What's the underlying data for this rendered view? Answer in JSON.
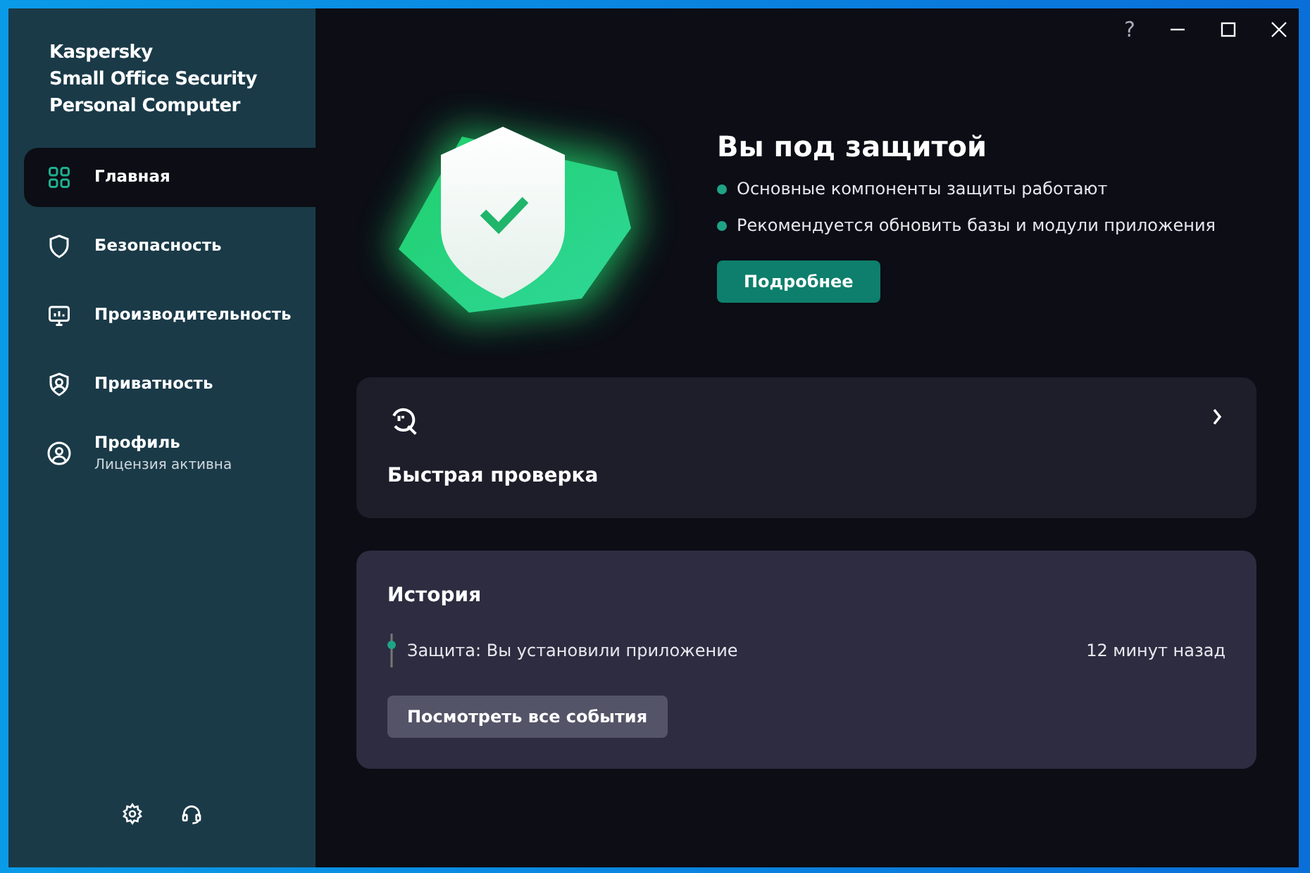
{
  "app": {
    "title_lines": [
      "Kaspersky",
      "Small Office Security",
      "Personal Computer"
    ]
  },
  "nav": [
    {
      "label": "Главная",
      "selected": true
    },
    {
      "label": "Безопасность",
      "selected": false
    },
    {
      "label": "Производительность",
      "selected": false
    },
    {
      "label": "Приватность",
      "selected": false
    },
    {
      "label": "Профиль",
      "sublabel": "Лицензия активна",
      "selected": false
    }
  ],
  "help": "?",
  "status": {
    "title": "Вы под защитой",
    "items": [
      "Основные компоненты защиты работают",
      "Рекомендуется обновить базы и модули приложения"
    ],
    "button": "Подробнее"
  },
  "quick_scan": {
    "title": "Быстрая проверка"
  },
  "history": {
    "title": "История",
    "events": [
      {
        "text": "Защита: Вы установили приложение",
        "time": "12 минут назад"
      }
    ],
    "button": "Посмотреть все события"
  }
}
